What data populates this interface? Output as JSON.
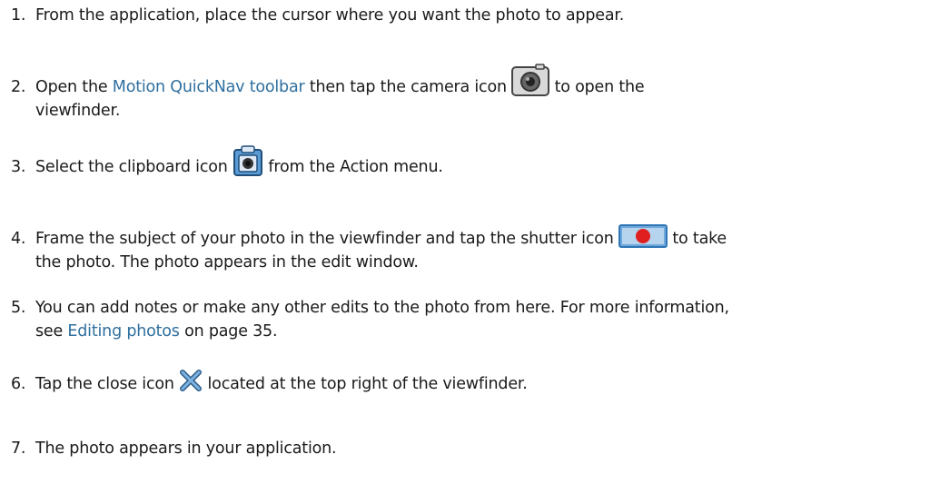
{
  "steps": [
    {
      "num": "1.",
      "text": "From the application, place the cursor where you want the photo to appear."
    },
    {
      "num": "2.",
      "pre": "Open the ",
      "link": "Motion QuickNav toolbar",
      "mid": " then tap the camera icon ",
      "icon": "camera-icon",
      "post": " to open the",
      "cont": "viewfinder."
    },
    {
      "num": "3.",
      "pre": "Select the clipboard icon ",
      "icon": "clipboard-camera-icon",
      "post": " from the Action menu."
    },
    {
      "num": "4.",
      "pre": "Frame the subject of your photo in the viewfinder and tap the shutter icon ",
      "icon": "shutter-icon",
      "post": " to take",
      "cont": "the photo. The photo appears in the edit window."
    },
    {
      "num": "5.",
      "text": "You can add notes or make any other edits to the photo from here. For more information,",
      "cont_link": "Editing photos",
      "cont_pre": "see ",
      "cont_post": " on page 35."
    },
    {
      "num": "6.",
      "pre": "Tap the close icon ",
      "icon": "close-icon",
      "post": " located at the top right of the viewfinder."
    },
    {
      "num": "7.",
      "text": "The photo appears in your application."
    }
  ],
  "colors": {
    "link": "#2f6f9f",
    "icon_blue": "#5b9bd5",
    "shutter_red": "#e02020"
  }
}
